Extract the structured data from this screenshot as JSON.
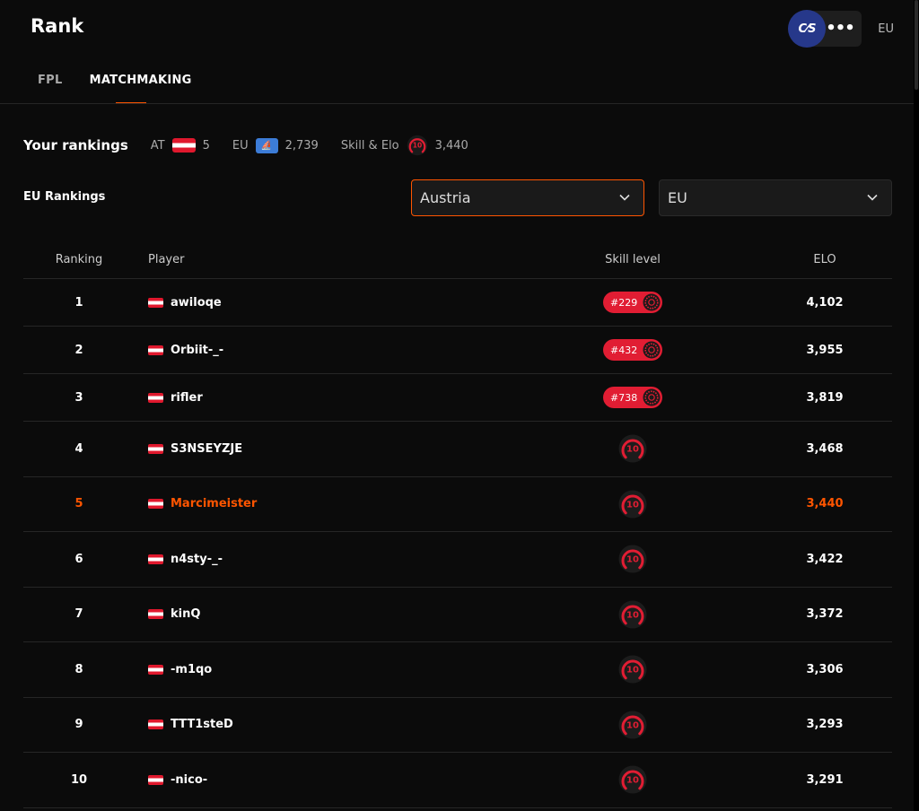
{
  "header": {
    "title": "Rank",
    "game_logo": "C⁄S",
    "more_label": "•••",
    "region": "EU"
  },
  "tabs": [
    {
      "label": "FPL",
      "active": false
    },
    {
      "label": "MATCHMAKING",
      "active": true
    }
  ],
  "your_rankings": {
    "title": "Your rankings",
    "country": {
      "label": "AT",
      "value": "5"
    },
    "region": {
      "label": "EU",
      "value": "2,739"
    },
    "skill": {
      "label": "Skill & Elo",
      "level": "10",
      "value": "3,440"
    }
  },
  "eu_rankings": {
    "title": "EU Rankings",
    "country_select": "Austria",
    "region_select": "EU"
  },
  "table": {
    "headers": {
      "rank": "Ranking",
      "player": "Player",
      "skill": "Skill level",
      "elo": "ELO"
    },
    "rows": [
      {
        "rank": "1",
        "player": "awiloqe",
        "skill_badge": "#229",
        "elo": "4,102"
      },
      {
        "rank": "2",
        "player": "Orbiit-_-",
        "skill_badge": "#432",
        "elo": "3,955"
      },
      {
        "rank": "3",
        "player": "rifler",
        "skill_badge": "#738",
        "elo": "3,819"
      },
      {
        "rank": "4",
        "player": "S3NSEYZJE",
        "skill_level": "10",
        "elo": "3,468"
      },
      {
        "rank": "5",
        "player": "Marcimeister",
        "skill_level": "10",
        "elo": "3,440",
        "highlight": true
      },
      {
        "rank": "6",
        "player": "n4sty-_-",
        "skill_level": "10",
        "elo": "3,422"
      },
      {
        "rank": "7",
        "player": "kinQ",
        "skill_level": "10",
        "elo": "3,372"
      },
      {
        "rank": "8",
        "player": "-m1qo",
        "skill_level": "10",
        "elo": "3,306"
      },
      {
        "rank": "9",
        "player": "TTT1steD",
        "skill_level": "10",
        "elo": "3,293"
      },
      {
        "rank": "10",
        "player": "-nico-",
        "skill_level": "10",
        "elo": "3,291"
      }
    ]
  },
  "colors": {
    "accent": "#ff5500",
    "badge_red": "#e11d33",
    "background": "#0b0b0b"
  }
}
